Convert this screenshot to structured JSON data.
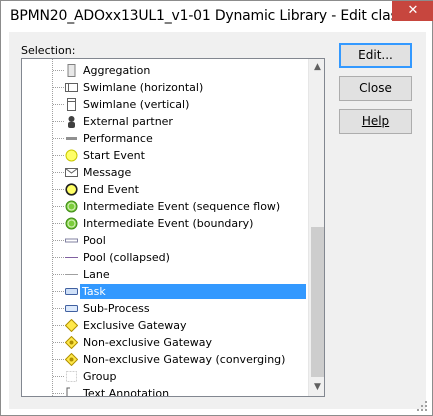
{
  "window": {
    "title": "BPMN20_ADOxx13UL1_v1-01 Dynamic Library - Edit clas"
  },
  "close_glyph": "✕",
  "selection_label": "Selection:",
  "list": {
    "items": [
      {
        "label": "Aggregation",
        "icon": "aggregation-icon"
      },
      {
        "label": "Swimlane (horizontal)",
        "icon": "swimlane-horizontal-icon"
      },
      {
        "label": "Swimlane (vertical)",
        "icon": "swimlane-vertical-icon"
      },
      {
        "label": "External partner",
        "icon": "external-partner-icon"
      },
      {
        "label": "Performance",
        "icon": "performance-icon"
      },
      {
        "label": "Start Event",
        "icon": "start-event-icon"
      },
      {
        "label": "Message",
        "icon": "message-icon"
      },
      {
        "label": "End Event",
        "icon": "end-event-icon"
      },
      {
        "label": "Intermediate Event (sequence flow)",
        "icon": "intermediate-event-sequence-icon"
      },
      {
        "label": "Intermediate Event (boundary)",
        "icon": "intermediate-event-boundary-icon"
      },
      {
        "label": "Pool",
        "icon": "pool-icon"
      },
      {
        "label": "Pool (collapsed)",
        "icon": "pool-collapsed-icon"
      },
      {
        "label": "Lane",
        "icon": "lane-icon"
      },
      {
        "label": "Task",
        "icon": "task-icon",
        "selected": true
      },
      {
        "label": "Sub-Process",
        "icon": "sub-process-icon"
      },
      {
        "label": "Exclusive Gateway",
        "icon": "exclusive-gateway-icon"
      },
      {
        "label": "Non-exclusive Gateway",
        "icon": "non-exclusive-gateway-icon"
      },
      {
        "label": "Non-exclusive Gateway (converging)",
        "icon": "non-exclusive-gateway-converging-icon"
      },
      {
        "label": "Group",
        "icon": "group-icon"
      },
      {
        "label": "Text Annotation",
        "icon": "text-annotation-icon"
      }
    ]
  },
  "scroll_up_glyph": "▲",
  "scroll_down_glyph": "▼",
  "buttons": {
    "edit": "Edit...",
    "close": "Close",
    "help": "Help"
  },
  "colors": {
    "selection": "#3399ff",
    "close_button": "#c7463e"
  }
}
